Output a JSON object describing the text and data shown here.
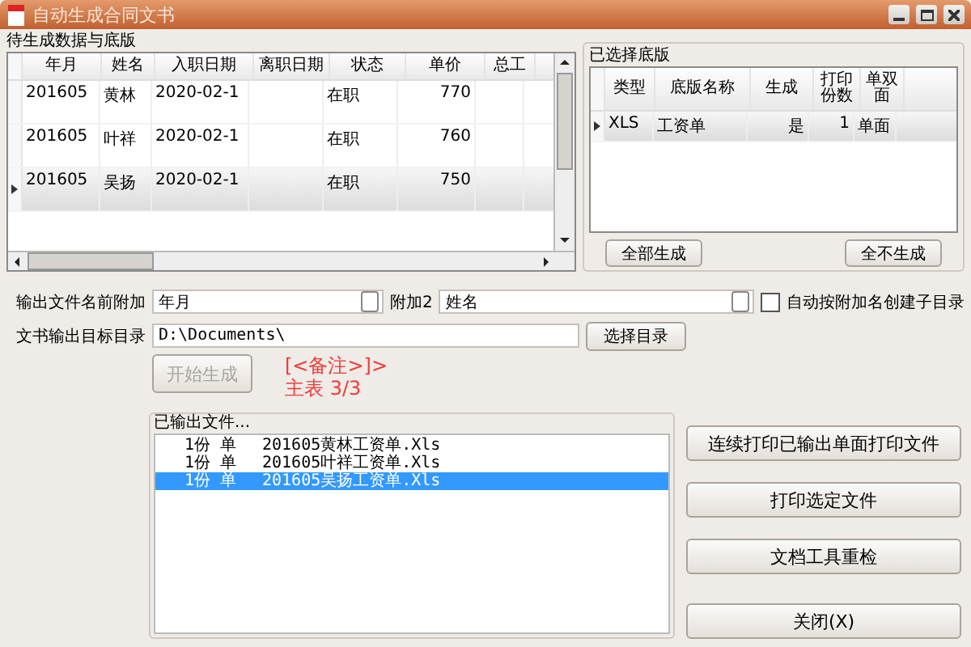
{
  "window": {
    "title": "自动生成合同文书"
  },
  "data_group": {
    "title": "待生成数据与底版",
    "columns": [
      "年月",
      "姓名",
      "入职日期",
      "离职日期",
      "状态",
      "单价",
      "总工"
    ],
    "rows": [
      {
        "cells": [
          "201605",
          "黄林",
          "2020-02-1",
          null,
          "在职",
          "770",
          null
        ],
        "selected": false
      },
      {
        "cells": [
          "201605",
          "叶祥",
          "2020-02-1",
          null,
          "在职",
          "760",
          null
        ],
        "selected": false
      },
      {
        "cells": [
          "201605",
          "吴扬",
          "2020-02-1",
          null,
          "在职",
          "750",
          null
        ],
        "selected": true
      }
    ]
  },
  "template_group": {
    "title": "已选择底版",
    "columns": [
      "类型",
      "底版名称",
      "生成",
      "打印份数",
      "单双面"
    ],
    "rows": [
      {
        "cells": [
          "XLS",
          "工资单",
          "是",
          "1",
          "单面"
        ],
        "selected": true
      }
    ],
    "buttons": [
      "全部生成",
      "全不生成"
    ]
  },
  "form": {
    "prefix_label": "输出文件名前附加",
    "prefix_value": "年月",
    "extra_label": "附加2",
    "extra_value": "姓名",
    "subdir_checkbox": {
      "label": "自动按附加名创建子目录",
      "checked": false
    },
    "dir_label": "文书输出目标目录",
    "dir_value": "D:\\Documents\\",
    "dir_button": "选择目录",
    "start_button": {
      "label": "开始生成",
      "disabled": true
    },
    "status_lines": [
      "[<备注>]>",
      "主表 3/3"
    ]
  },
  "output_group": {
    "title": "已输出文件...",
    "items": [
      {
        "copies": "1份",
        "side": "单",
        "file": "201605黄林工资单.Xls",
        "selected": false
      },
      {
        "copies": "1份",
        "side": "单",
        "file": "201605叶祥工资单.Xls",
        "selected": false
      },
      {
        "copies": "1份",
        "side": "单",
        "file": "201605吴扬工资单.Xls",
        "selected": true
      }
    ]
  },
  "action_buttons": [
    "连续打印已输出单面打印文件",
    "打印选定文件",
    "文档工具重检",
    "关闭(X)"
  ]
}
